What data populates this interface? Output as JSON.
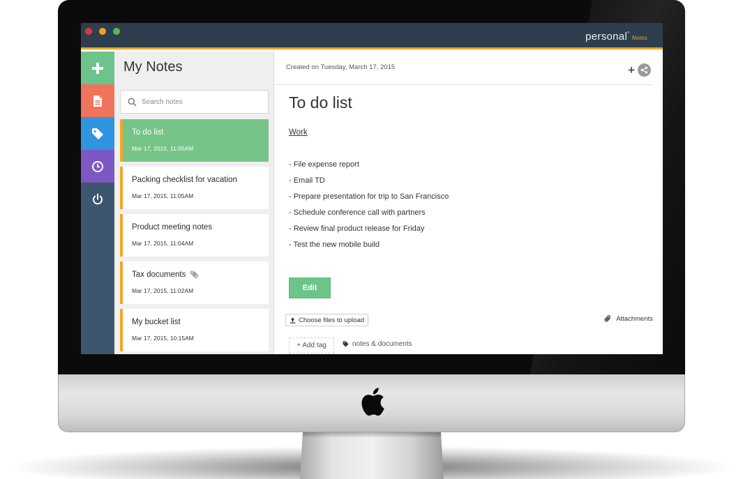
{
  "window": {
    "brand": "personal",
    "brand_mark": "°",
    "brand_sub": "Notes",
    "accent_color": "#f4a622"
  },
  "rail": {
    "items": [
      {
        "icon": "plus-icon",
        "color": "#6cc48a"
      },
      {
        "icon": "document-icon",
        "color": "#f0735c"
      },
      {
        "icon": "tag-icon",
        "color": "#2f95e0"
      },
      {
        "icon": "clock-icon",
        "color": "#7d57c2"
      },
      {
        "icon": "power-icon",
        "color": "#3c5670"
      }
    ]
  },
  "list": {
    "title": "My Notes",
    "search_placeholder": "Search notes",
    "notes": [
      {
        "title": "To do list",
        "date": "Mar 17, 2015, 11:05AM",
        "active": true
      },
      {
        "title": "Packing checklist for vacation",
        "date": "Mar 17, 2015, 11:05AM"
      },
      {
        "title": "Product meeting notes",
        "date": "Mar 17, 2015, 11:04AM"
      },
      {
        "title": "Tax documents",
        "date": "Mar 17, 2015, 11:02AM",
        "attachment_icon": "paperclip-icon"
      },
      {
        "title": "My bucket list",
        "date": "Mar 17, 2015, 10:15AM"
      }
    ]
  },
  "detail": {
    "created": "Created on Tuesday, March 17, 2015",
    "title": "To do list",
    "section": "Work",
    "items": [
      "- File expense report",
      "- Email TD",
      "- Prepare presentation for trip to San Francisco",
      "- Schedule conference call with partners",
      "- Review final product release for Friday",
      "- Test the new mobile build"
    ],
    "edit_label": "Edit",
    "upload_label": "Choose files to upload",
    "attachments_label": "Attachments",
    "add_tag_label": "+ Add tag",
    "tag": "notes & documents"
  }
}
